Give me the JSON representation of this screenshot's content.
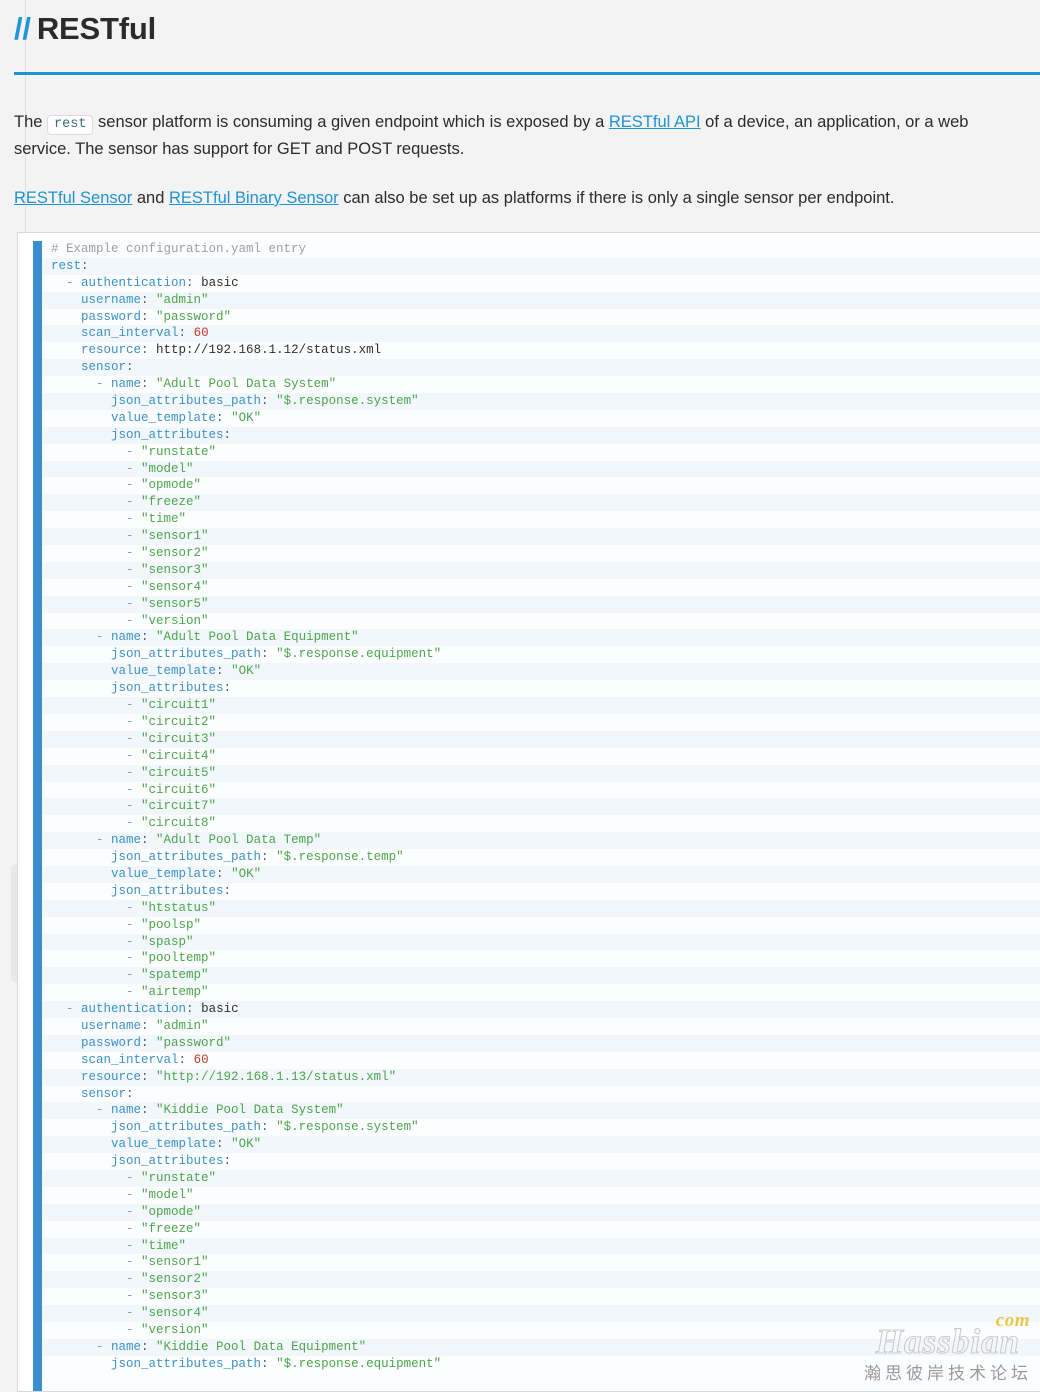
{
  "header": {
    "slashes": "//",
    "title": "RESTful"
  },
  "prose": {
    "p1_before_code": "The ",
    "inline_code": "rest",
    "p1_after_code": " sensor platform is consuming a given endpoint which is exposed by a ",
    "p1_link": "RESTful API",
    "p1_tail": " of a device, an application, or a web service. The sensor has support for GET and POST requests.",
    "p2_link1": "RESTful Sensor",
    "p2_mid": " and ",
    "p2_link2": "RESTful Binary Sensor",
    "p2_tail": " can also be set up as platforms if there is only a single sensor per endpoint."
  },
  "code": {
    "language": "yaml",
    "lines": [
      [
        [
          "# Example configuration.yaml entry",
          "t-com"
        ]
      ],
      [
        [
          "rest",
          "t-key"
        ],
        [
          ":",
          "t-pun"
        ]
      ],
      [
        [
          "  - ",
          "t-dash"
        ],
        [
          "authentication",
          "t-key"
        ],
        [
          ": ",
          "t-pun"
        ],
        [
          "basic",
          "t-pln"
        ]
      ],
      [
        [
          "    ",
          "t-pln"
        ],
        [
          "username",
          "t-key"
        ],
        [
          ": ",
          "t-pun"
        ],
        [
          "\"admin\"",
          "t-str"
        ]
      ],
      [
        [
          "    ",
          "t-pln"
        ],
        [
          "password",
          "t-key"
        ],
        [
          ": ",
          "t-pun"
        ],
        [
          "\"password\"",
          "t-str"
        ]
      ],
      [
        [
          "    ",
          "t-pln"
        ],
        [
          "scan_interval",
          "t-key"
        ],
        [
          ": ",
          "t-pun"
        ],
        [
          "60",
          "t-num"
        ]
      ],
      [
        [
          "    ",
          "t-pln"
        ],
        [
          "resource",
          "t-key"
        ],
        [
          ": ",
          "t-pun"
        ],
        [
          "http://192.168.1.12/status.xml",
          "t-pln"
        ]
      ],
      [
        [
          "    ",
          "t-pln"
        ],
        [
          "sensor",
          "t-key"
        ],
        [
          ":",
          "t-pun"
        ]
      ],
      [
        [
          "      - ",
          "t-dash"
        ],
        [
          "name",
          "t-key"
        ],
        [
          ": ",
          "t-pun"
        ],
        [
          "\"Adult Pool Data System\"",
          "t-str"
        ]
      ],
      [
        [
          "        ",
          "t-pln"
        ],
        [
          "json_attributes_path",
          "t-key"
        ],
        [
          ": ",
          "t-pun"
        ],
        [
          "\"$.response.system\"",
          "t-str"
        ]
      ],
      [
        [
          "        ",
          "t-pln"
        ],
        [
          "value_template",
          "t-key"
        ],
        [
          ": ",
          "t-pun"
        ],
        [
          "\"OK\"",
          "t-str"
        ]
      ],
      [
        [
          "        ",
          "t-pln"
        ],
        [
          "json_attributes",
          "t-key"
        ],
        [
          ":",
          "t-pun"
        ]
      ],
      [
        [
          "          - ",
          "t-dash"
        ],
        [
          "\"runstate\"",
          "t-str"
        ]
      ],
      [
        [
          "          - ",
          "t-dash"
        ],
        [
          "\"model\"",
          "t-str"
        ]
      ],
      [
        [
          "          - ",
          "t-dash"
        ],
        [
          "\"opmode\"",
          "t-str"
        ]
      ],
      [
        [
          "          - ",
          "t-dash"
        ],
        [
          "\"freeze\"",
          "t-str"
        ]
      ],
      [
        [
          "          - ",
          "t-dash"
        ],
        [
          "\"time\"",
          "t-str"
        ]
      ],
      [
        [
          "          - ",
          "t-dash"
        ],
        [
          "\"sensor1\"",
          "t-str"
        ]
      ],
      [
        [
          "          - ",
          "t-dash"
        ],
        [
          "\"sensor2\"",
          "t-str"
        ]
      ],
      [
        [
          "          - ",
          "t-dash"
        ],
        [
          "\"sensor3\"",
          "t-str"
        ]
      ],
      [
        [
          "          - ",
          "t-dash"
        ],
        [
          "\"sensor4\"",
          "t-str"
        ]
      ],
      [
        [
          "          - ",
          "t-dash"
        ],
        [
          "\"sensor5\"",
          "t-str"
        ]
      ],
      [
        [
          "          - ",
          "t-dash"
        ],
        [
          "\"version\"",
          "t-str"
        ]
      ],
      [
        [
          "      - ",
          "t-dash"
        ],
        [
          "name",
          "t-key"
        ],
        [
          ": ",
          "t-pun"
        ],
        [
          "\"Adult Pool Data Equipment\"",
          "t-str"
        ]
      ],
      [
        [
          "        ",
          "t-pln"
        ],
        [
          "json_attributes_path",
          "t-key"
        ],
        [
          ": ",
          "t-pun"
        ],
        [
          "\"$.response.equipment\"",
          "t-str"
        ]
      ],
      [
        [
          "        ",
          "t-pln"
        ],
        [
          "value_template",
          "t-key"
        ],
        [
          ": ",
          "t-pun"
        ],
        [
          "\"OK\"",
          "t-str"
        ]
      ],
      [
        [
          "        ",
          "t-pln"
        ],
        [
          "json_attributes",
          "t-key"
        ],
        [
          ":",
          "t-pun"
        ]
      ],
      [
        [
          "          - ",
          "t-dash"
        ],
        [
          "\"circuit1\"",
          "t-str"
        ]
      ],
      [
        [
          "          - ",
          "t-dash"
        ],
        [
          "\"circuit2\"",
          "t-str"
        ]
      ],
      [
        [
          "          - ",
          "t-dash"
        ],
        [
          "\"circuit3\"",
          "t-str"
        ]
      ],
      [
        [
          "          - ",
          "t-dash"
        ],
        [
          "\"circuit4\"",
          "t-str"
        ]
      ],
      [
        [
          "          - ",
          "t-dash"
        ],
        [
          "\"circuit5\"",
          "t-str"
        ]
      ],
      [
        [
          "          - ",
          "t-dash"
        ],
        [
          "\"circuit6\"",
          "t-str"
        ]
      ],
      [
        [
          "          - ",
          "t-dash"
        ],
        [
          "\"circuit7\"",
          "t-str"
        ]
      ],
      [
        [
          "          - ",
          "t-dash"
        ],
        [
          "\"circuit8\"",
          "t-str"
        ]
      ],
      [
        [
          "      - ",
          "t-dash"
        ],
        [
          "name",
          "t-key"
        ],
        [
          ": ",
          "t-pun"
        ],
        [
          "\"Adult Pool Data Temp\"",
          "t-str"
        ]
      ],
      [
        [
          "        ",
          "t-pln"
        ],
        [
          "json_attributes_path",
          "t-key"
        ],
        [
          ": ",
          "t-pun"
        ],
        [
          "\"$.response.temp\"",
          "t-str"
        ]
      ],
      [
        [
          "        ",
          "t-pln"
        ],
        [
          "value_template",
          "t-key"
        ],
        [
          ": ",
          "t-pun"
        ],
        [
          "\"OK\"",
          "t-str"
        ]
      ],
      [
        [
          "        ",
          "t-pln"
        ],
        [
          "json_attributes",
          "t-key"
        ],
        [
          ":",
          "t-pun"
        ]
      ],
      [
        [
          "          - ",
          "t-dash"
        ],
        [
          "\"htstatus\"",
          "t-str"
        ]
      ],
      [
        [
          "          - ",
          "t-dash"
        ],
        [
          "\"poolsp\"",
          "t-str"
        ]
      ],
      [
        [
          "          - ",
          "t-dash"
        ],
        [
          "\"spasp\"",
          "t-str"
        ]
      ],
      [
        [
          "          - ",
          "t-dash"
        ],
        [
          "\"pooltemp\"",
          "t-str"
        ]
      ],
      [
        [
          "          - ",
          "t-dash"
        ],
        [
          "\"spatemp\"",
          "t-str"
        ]
      ],
      [
        [
          "          - ",
          "t-dash"
        ],
        [
          "\"airtemp\"",
          "t-str"
        ]
      ],
      [
        [
          "  - ",
          "t-dash"
        ],
        [
          "authentication",
          "t-key"
        ],
        [
          ": ",
          "t-pun"
        ],
        [
          "basic",
          "t-pln"
        ]
      ],
      [
        [
          "    ",
          "t-pln"
        ],
        [
          "username",
          "t-key"
        ],
        [
          ": ",
          "t-pun"
        ],
        [
          "\"admin\"",
          "t-str"
        ]
      ],
      [
        [
          "    ",
          "t-pln"
        ],
        [
          "password",
          "t-key"
        ],
        [
          ": ",
          "t-pun"
        ],
        [
          "\"password\"",
          "t-str"
        ]
      ],
      [
        [
          "    ",
          "t-pln"
        ],
        [
          "scan_interval",
          "t-key"
        ],
        [
          ": ",
          "t-pun"
        ],
        [
          "60",
          "t-num"
        ]
      ],
      [
        [
          "    ",
          "t-pln"
        ],
        [
          "resource",
          "t-key"
        ],
        [
          ": ",
          "t-pun"
        ],
        [
          "\"http://192.168.1.13/status.xml\"",
          "t-str"
        ]
      ],
      [
        [
          "    ",
          "t-pln"
        ],
        [
          "sensor",
          "t-key"
        ],
        [
          ":",
          "t-pun"
        ]
      ],
      [
        [
          "      - ",
          "t-dash"
        ],
        [
          "name",
          "t-key"
        ],
        [
          ": ",
          "t-pun"
        ],
        [
          "\"Kiddie Pool Data System\"",
          "t-str"
        ]
      ],
      [
        [
          "        ",
          "t-pln"
        ],
        [
          "json_attributes_path",
          "t-key"
        ],
        [
          ": ",
          "t-pun"
        ],
        [
          "\"$.response.system\"",
          "t-str"
        ]
      ],
      [
        [
          "        ",
          "t-pln"
        ],
        [
          "value_template",
          "t-key"
        ],
        [
          ": ",
          "t-pun"
        ],
        [
          "\"OK\"",
          "t-str"
        ]
      ],
      [
        [
          "        ",
          "t-pln"
        ],
        [
          "json_attributes",
          "t-key"
        ],
        [
          ":",
          "t-pun"
        ]
      ],
      [
        [
          "          - ",
          "t-dash"
        ],
        [
          "\"runstate\"",
          "t-str"
        ]
      ],
      [
        [
          "          - ",
          "t-dash"
        ],
        [
          "\"model\"",
          "t-str"
        ]
      ],
      [
        [
          "          - ",
          "t-dash"
        ],
        [
          "\"opmode\"",
          "t-str"
        ]
      ],
      [
        [
          "          - ",
          "t-dash"
        ],
        [
          "\"freeze\"",
          "t-str"
        ]
      ],
      [
        [
          "          - ",
          "t-dash"
        ],
        [
          "\"time\"",
          "t-str"
        ]
      ],
      [
        [
          "          - ",
          "t-dash"
        ],
        [
          "\"sensor1\"",
          "t-str"
        ]
      ],
      [
        [
          "          - ",
          "t-dash"
        ],
        [
          "\"sensor2\"",
          "t-str"
        ]
      ],
      [
        [
          "          - ",
          "t-dash"
        ],
        [
          "\"sensor3\"",
          "t-str"
        ]
      ],
      [
        [
          "          - ",
          "t-dash"
        ],
        [
          "\"sensor4\"",
          "t-str"
        ]
      ],
      [
        [
          "          - ",
          "t-dash"
        ],
        [
          "\"version\"",
          "t-str"
        ]
      ],
      [
        [
          "      - ",
          "t-dash"
        ],
        [
          "name",
          "t-key"
        ],
        [
          ": ",
          "t-pun"
        ],
        [
          "\"Kiddie Pool Data Equipment\"",
          "t-str"
        ]
      ],
      [
        [
          "        ",
          "t-pln"
        ],
        [
          "json_attributes_path",
          "t-key"
        ],
        [
          ": ",
          "t-pun"
        ],
        [
          "\"$.response.equipment\"",
          "t-str"
        ]
      ]
    ]
  },
  "watermark": {
    "main": "Hassbian",
    "com": "com",
    "cn": "瀚思彼岸技术论坛"
  },
  "colors": {
    "accent": "#1d93d2",
    "code_bar": "#3a8ed0",
    "link": "#1d93d2",
    "string": "#4ca64c",
    "key": "#3c92c7",
    "number": "#c0392b",
    "comment": "#9aa2a8"
  }
}
